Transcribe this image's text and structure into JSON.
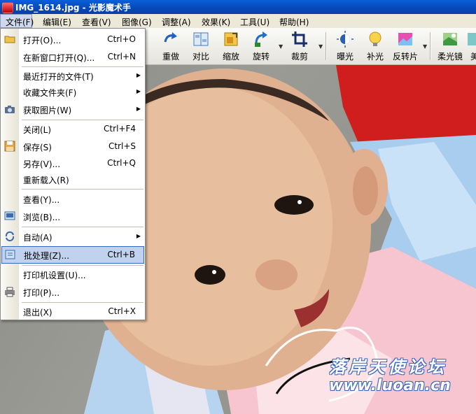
{
  "window": {
    "title": "IMG_1614.jpg - 光影魔术手"
  },
  "menubar": {
    "items": [
      "文件(F)",
      "编辑(E)",
      "查看(V)",
      "图像(G)",
      "调整(A)",
      "效果(K)",
      "工具(U)",
      "帮助(H)"
    ]
  },
  "toolbar": {
    "buttons": [
      "重做",
      "对比",
      "缩放",
      "旋转",
      "裁剪",
      "曝光",
      "补光",
      "反转片",
      "柔光镜",
      "美"
    ]
  },
  "file_menu": {
    "items": [
      {
        "label": "打开(O)...",
        "shortcut": "Ctrl+O"
      },
      {
        "label": "在新窗口打开(Q)...",
        "shortcut": "Ctrl+N"
      },
      {
        "label": "最近打开的文件(T)",
        "shortcut": ""
      },
      {
        "label": "收藏文件夹(F)",
        "shortcut": ""
      },
      {
        "label": "获取图片(W)",
        "shortcut": ""
      },
      {
        "label": "关闭(L)",
        "shortcut": "Ctrl+F4"
      },
      {
        "label": "保存(S)",
        "shortcut": "Ctrl+S"
      },
      {
        "label": "另存(V)...",
        "shortcut": "Ctrl+Q"
      },
      {
        "label": "重新载入(R)",
        "shortcut": ""
      },
      {
        "label": "查看(Y)...",
        "shortcut": ""
      },
      {
        "label": "浏览(B)...",
        "shortcut": ""
      },
      {
        "label": "自动(A)",
        "shortcut": ""
      },
      {
        "label": "批处理(Z)...",
        "shortcut": "Ctrl+B"
      },
      {
        "label": "打印机设置(U)...",
        "shortcut": ""
      },
      {
        "label": "打印(P)...",
        "shortcut": ""
      },
      {
        "label": "退出(X)",
        "shortcut": "Ctrl+X"
      }
    ],
    "highlighted": "批处理(Z)..."
  },
  "watermark": {
    "text": "落岸天使论坛",
    "url": "www.luoan.cn"
  },
  "colors": {
    "titlebar": "#0747b8",
    "menu_highlight": "#c1d2ee",
    "menu_border": "#316ac5"
  }
}
